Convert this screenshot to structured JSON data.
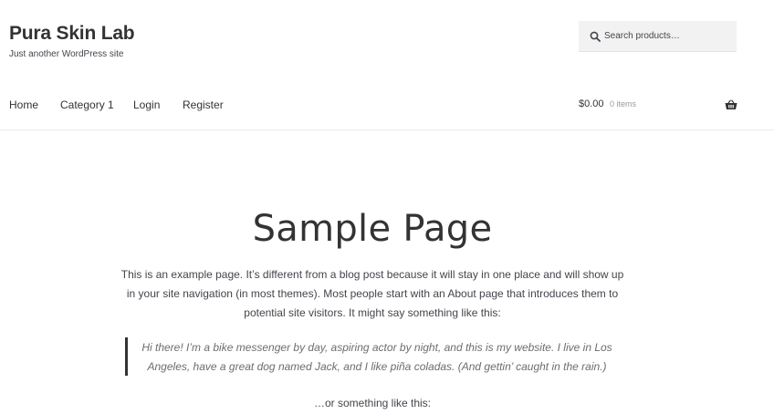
{
  "header": {
    "site_title": "Pura Skin Lab",
    "tagline": "Just another WordPress site",
    "search": {
      "placeholder": "Search products…",
      "icon": "search-icon"
    },
    "nav": [
      {
        "label": "Home"
      },
      {
        "label": "Category 1"
      },
      {
        "label": "Login"
      },
      {
        "label": "Register"
      }
    ],
    "cart": {
      "amount": "$0.00",
      "count": "0 items",
      "icon": "basket-icon"
    }
  },
  "main": {
    "title": "Sample Page",
    "intro": "This is an example page. It’s different from a blog post because it will stay in one place and will show up in your site navigation (in most themes). Most people start with an About page that introduces them to potential site visitors. It might say something like this:",
    "quote": "Hi there! I’m a bike messenger by day, aspiring actor by night, and this is my website. I live in Los Angeles, have a great dog named Jack, and I like piña coladas. (And gettin’ caught in the rain.)",
    "outro": "…or something like this:"
  },
  "colors": {
    "text": "#43454b",
    "heading": "#333333",
    "search_bg": "#f2f2f2",
    "quote_border": "#333333"
  }
}
